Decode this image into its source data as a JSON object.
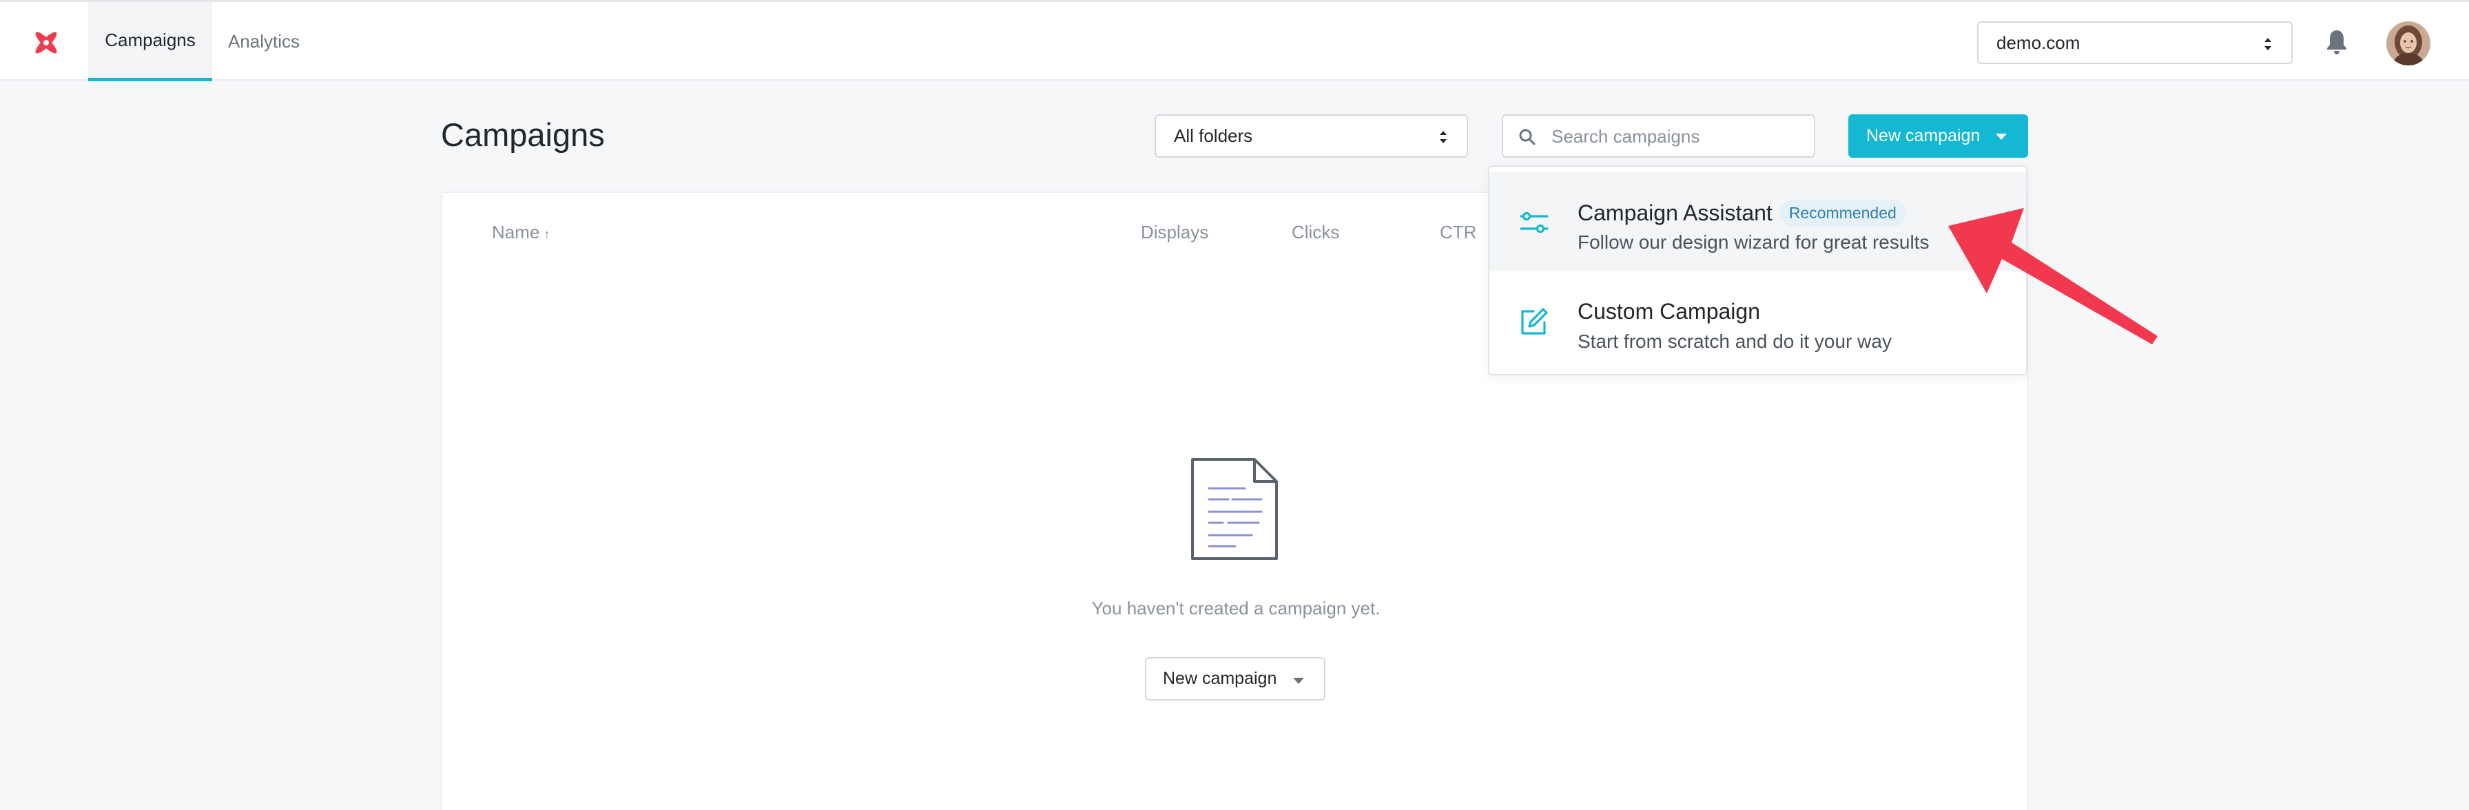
{
  "nav": {
    "logo_icon": "brand-flower-logo",
    "tabs": [
      {
        "label": "Campaigns",
        "active": true
      },
      {
        "label": "Analytics",
        "active": false
      }
    ],
    "domain_select": {
      "value": "demo.com"
    },
    "bell_icon": "bell-icon",
    "avatar_icon": "user-avatar"
  },
  "header": {
    "title": "Campaigns",
    "folder_select": {
      "value": "All folders"
    },
    "search": {
      "placeholder": "Search campaigns",
      "value": ""
    },
    "new_campaign_label": "New campaign"
  },
  "table": {
    "columns": [
      {
        "label": "Name",
        "sort": "ascending"
      },
      {
        "label": "Displays"
      },
      {
        "label": "Clicks"
      },
      {
        "label": "CTR"
      }
    ],
    "empty_message": "You haven't created a campaign yet.",
    "empty_button_label": "New campaign"
  },
  "dropdown": {
    "items": [
      {
        "title": "Campaign Assistant",
        "badge": "Recommended",
        "description": "Follow our design wizard for great results",
        "icon": "sliders-icon",
        "highlighted": true
      },
      {
        "title": "Custom Campaign",
        "description": "Start from scratch and do it your way",
        "icon": "edit-square-icon",
        "highlighted": false
      }
    ]
  },
  "colors": {
    "accent": "#14b8d2",
    "logo_red": "#ef3b4f",
    "annotation_arrow": "#f2384f",
    "badge_bg": "#e6f1f7",
    "badge_text": "#2c7fb2"
  }
}
